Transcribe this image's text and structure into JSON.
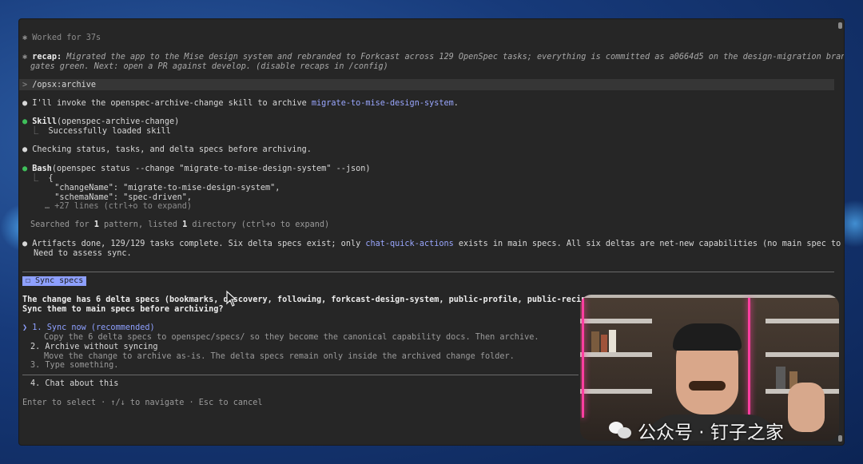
{
  "terminal": {
    "worked_marker": "✱",
    "worked": "Worked for 37s",
    "recap_label": "recap:",
    "recap_line1": "Migrated the app to the Mise design system and rebranded to Forkcast across 129 OpenSpec tasks; everything is committed as a0664d5 on the design-migration branch with all",
    "recap_line2": "gates green. Next: open a PR against develop. (disable recaps in /config)",
    "prompt_glyph": ">",
    "prompt_command": "/opsx:archive",
    "bullet": "●",
    "msg1_prefix": "I'll invoke the openspec-archive-change skill to archive ",
    "msg1_link": "migrate-to-mise-design-system",
    "msg1_suffix": ".",
    "skill_name": "Skill",
    "skill_arg": "(openspec-archive-change)",
    "skill_result": "Successfully loaded skill",
    "msg2": "Checking status, tasks, and delta specs before archiving.",
    "bash_name": "Bash",
    "bash_arg": "(openspec status --change \"migrate-to-mise-design-system\" --json)",
    "bash_out1": "{",
    "bash_out2": "  \"changeName\": \"migrate-to-mise-design-system\",",
    "bash_out3": "  \"schemaName\": \"spec-driven\",",
    "bash_more": "… +27 lines (ctrl+o to expand)",
    "searched_prefix": "Searched for ",
    "searched_n1": "1",
    "searched_mid": " pattern, listed ",
    "searched_n2": "1",
    "searched_suffix": " directory (ctrl+o to expand)",
    "msg3_prefix": "Artifacts done, 129/129 tasks complete. Six delta specs exist; only ",
    "msg3_link": "chat-quick-actions",
    "msg3_suffix": " exists in main specs. All six deltas are net-new capabilities (no main spec to merge into).",
    "msg3_line2": "Need to assess sync."
  },
  "question": {
    "tab_label": "☐ Sync specs",
    "text_line1": "The change has 6 delta specs (bookmarks, discovery, following, forkcast-design-system, public-profile, public-recipe-detail) — all",
    "text_line1_tail": "/.",
    "text_line2": "Sync them to main specs before archiving?",
    "options": [
      {
        "marker": "❯",
        "num": "1.",
        "label": "Sync now (recommended)",
        "desc": "Copy the 6 delta specs to openspec/specs/ so they become the canonical capability docs. Then archive."
      },
      {
        "num": "2.",
        "label": "Archive without syncing",
        "desc": "Move the change to archive as-is. The delta specs remain only inside the archived change folder."
      },
      {
        "num": "3.",
        "label": "Type something."
      },
      {
        "num": "4.",
        "label": "Chat about this"
      }
    ],
    "hint": "Enter to select · ↑/↓ to navigate · Esc to cancel"
  },
  "watermark": {
    "text": "公众号 · 钉子之家"
  }
}
